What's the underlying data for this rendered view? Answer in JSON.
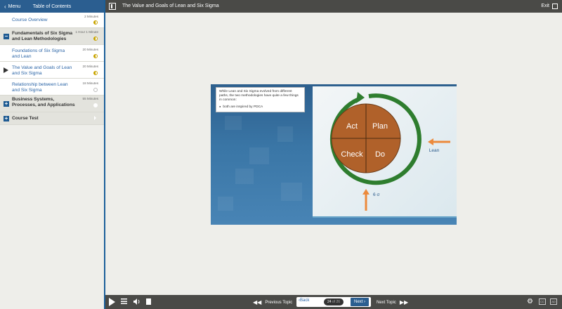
{
  "menu": {
    "label": "Menu",
    "title": "Table of Contents"
  },
  "toc": [
    {
      "type": "lesson",
      "title": "Course Overview",
      "duration": "2 Minutes",
      "progress": "half"
    },
    {
      "type": "section",
      "title": "Fundamentals of Six Sigma and Lean Methodologies",
      "duration": "1 Hour 1 Minute",
      "progress": "half",
      "expander": "−"
    },
    {
      "type": "lesson",
      "title": "Foundations of Six Sigma and Lean",
      "duration": "20 Minutes",
      "progress": "half"
    },
    {
      "type": "lesson",
      "title": "The Value and Goals of Lean and Six Sigma",
      "duration": "20 Minutes",
      "progress": "half",
      "current": true
    },
    {
      "type": "lesson",
      "title": "Relationship between Lean and Six Sigma",
      "duration": "18 Minutes",
      "progress": "empty"
    },
    {
      "type": "section",
      "title": "Business Systems, Processes, and Applications",
      "duration": "55 Minutes",
      "progress": "white",
      "expander": "+"
    },
    {
      "type": "section",
      "title": "Course Test",
      "duration": "",
      "progress": "",
      "expander": "+"
    }
  ],
  "header": {
    "title": "The Value and Goals of Lean and Six Sigma",
    "exit_label": "Exit"
  },
  "slide": {
    "note_text": "While Lean and Six Sigma evolved from different paths, the two methodologies have quite a few things in common:",
    "bullet": "both are inspired by PDCA",
    "pdca": [
      "Act",
      "Plan",
      "Check",
      "Do"
    ],
    "lean_label": "Lean",
    "six_sigma_label": "6 σ",
    "colors": {
      "quadrant": "#b0612a",
      "ring": "#2e7d2e",
      "arrow": "#ec8a3c"
    }
  },
  "footer": {
    "prev_topic": "Previous Topic",
    "back": "Back",
    "page_current": "24",
    "page_of": "of",
    "page_total": "26",
    "next": "Next",
    "next_topic": "Next Topic",
    "cc": "CC",
    "ad": "AD"
  }
}
